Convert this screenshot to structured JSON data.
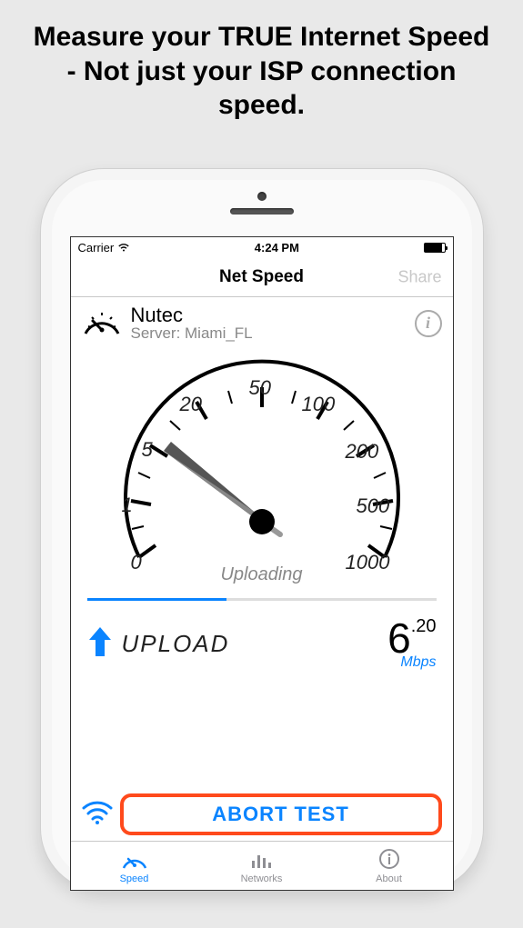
{
  "headline": "Measure your TRUE Internet Speed - Not just your ISP connection speed.",
  "status": {
    "carrier": "Carrier",
    "time": "4:24 PM"
  },
  "nav": {
    "title": "Net Speed",
    "share": "Share"
  },
  "provider": {
    "name": "Nutec",
    "server_label": "Server: Miami_FL"
  },
  "gauge": {
    "ticks": [
      "0",
      "1",
      "5",
      "20",
      "50",
      "100",
      "200",
      "500",
      "1000"
    ],
    "status": "Uploading",
    "progress_percent": 40
  },
  "upload": {
    "label": "UPLOAD",
    "value_int": "6",
    "value_dec": ".20",
    "unit": "Mbps"
  },
  "abort": {
    "label": "ABORT TEST"
  },
  "tabs": [
    {
      "label": "Speed",
      "active": true
    },
    {
      "label": "Networks",
      "active": false
    },
    {
      "label": "About",
      "active": false
    }
  ]
}
